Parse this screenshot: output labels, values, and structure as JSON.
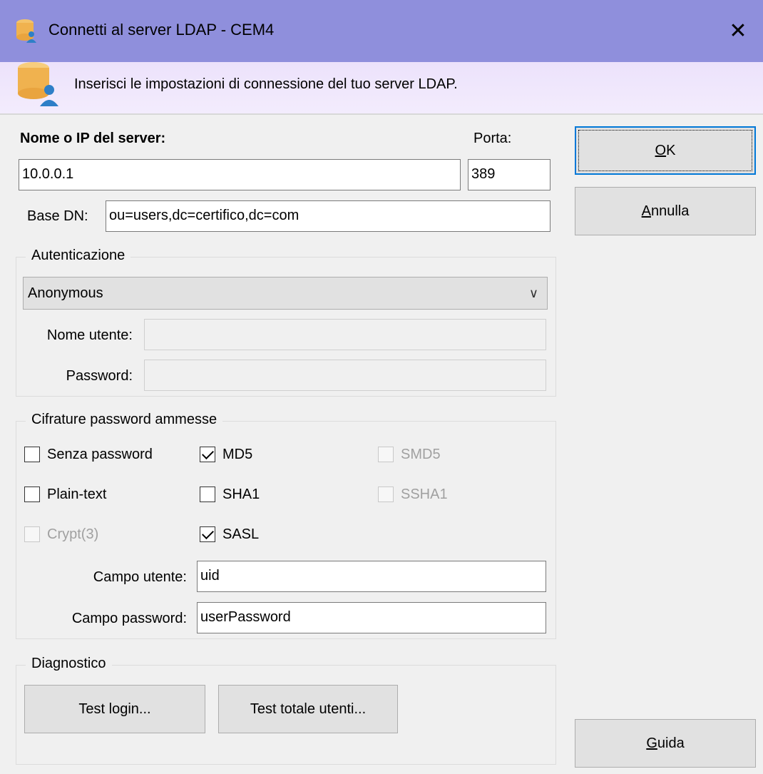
{
  "window": {
    "title": "Connetti al server LDAP - CEM4",
    "close_glyph": "✕",
    "icon": "database-user-icon"
  },
  "banner": {
    "text": "Inserisci le impostazioni di connessione del tuo server LDAP.",
    "icon": "database-user-icon"
  },
  "server": {
    "host_label": "Nome o IP del server:",
    "host_value": "10.0.0.1",
    "port_label": "Porta:",
    "port_value": "389",
    "basedn_label": "Base DN:",
    "basedn_value": "ou=users,dc=certifico,dc=com"
  },
  "auth": {
    "group_title": "Autenticazione",
    "method_selected": "Anonymous",
    "username_label": "Nome utente:",
    "username_value": "",
    "password_label": "Password:",
    "password_value": ""
  },
  "ciphers": {
    "group_title": "Cifrature password ammesse",
    "options": [
      {
        "label": "Senza password",
        "checked": false,
        "enabled": true
      },
      {
        "label": "MD5",
        "checked": true,
        "enabled": true
      },
      {
        "label": "SMD5",
        "checked": false,
        "enabled": false
      },
      {
        "label": "Plain-text",
        "checked": false,
        "enabled": true
      },
      {
        "label": "SHA1",
        "checked": false,
        "enabled": true
      },
      {
        "label": "SSHA1",
        "checked": false,
        "enabled": false
      },
      {
        "label": "Crypt(3)",
        "checked": false,
        "enabled": false
      },
      {
        "label": "SASL",
        "checked": true,
        "enabled": true
      }
    ],
    "user_field_label": "Campo utente:",
    "user_field_value": "uid",
    "password_field_label": "Campo password:",
    "password_field_value": "userPassword"
  },
  "diagnostics": {
    "group_title": "Diagnostico",
    "test_login": "Test login...",
    "test_total_users": "Test totale utenti..."
  },
  "buttons": {
    "ok_mnemonic": "O",
    "ok_rest": "K",
    "cancel_mnemonic": "A",
    "cancel_rest": "nnulla",
    "help_mnemonic": "G",
    "help_rest": "uida"
  },
  "colors": {
    "titlebar": "#8f8fdc",
    "banner": "#ece2fb",
    "default_button_border": "#0078d7"
  }
}
